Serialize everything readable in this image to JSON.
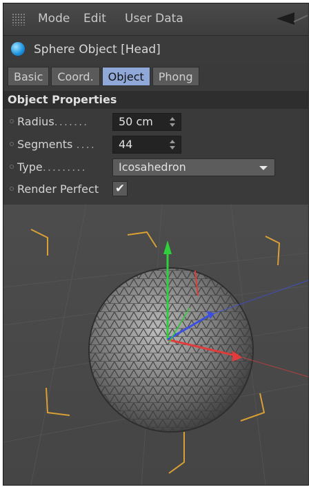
{
  "menubar": {
    "items": [
      "Mode",
      "Edit",
      "User Data"
    ]
  },
  "object": {
    "title": "Sphere Object [Head]",
    "icon": "sphere-icon"
  },
  "tabs": [
    {
      "label": "Basic",
      "active": false
    },
    {
      "label": "Coord.",
      "active": false
    },
    {
      "label": "Object",
      "active": true
    },
    {
      "label": "Phong",
      "active": false
    }
  ],
  "section": {
    "title": "Object Properties"
  },
  "params": {
    "radius": {
      "label": "Radius",
      "dots": ".......",
      "value": "50 cm"
    },
    "segments": {
      "label": "Segments",
      "dots": "....",
      "value": "44"
    },
    "type": {
      "label": "Type",
      "dots": ".........",
      "value": "Icosahedron"
    },
    "render_perfect": {
      "label": "Render Perfect",
      "checked": true,
      "mark": "✔"
    }
  },
  "colors": {
    "accent_tab": "#8fa8d8",
    "bracket": "#d9a033",
    "axis_x": "#e23b3b",
    "axis_y": "#2fd13b",
    "axis_z": "#3b4fe0"
  }
}
